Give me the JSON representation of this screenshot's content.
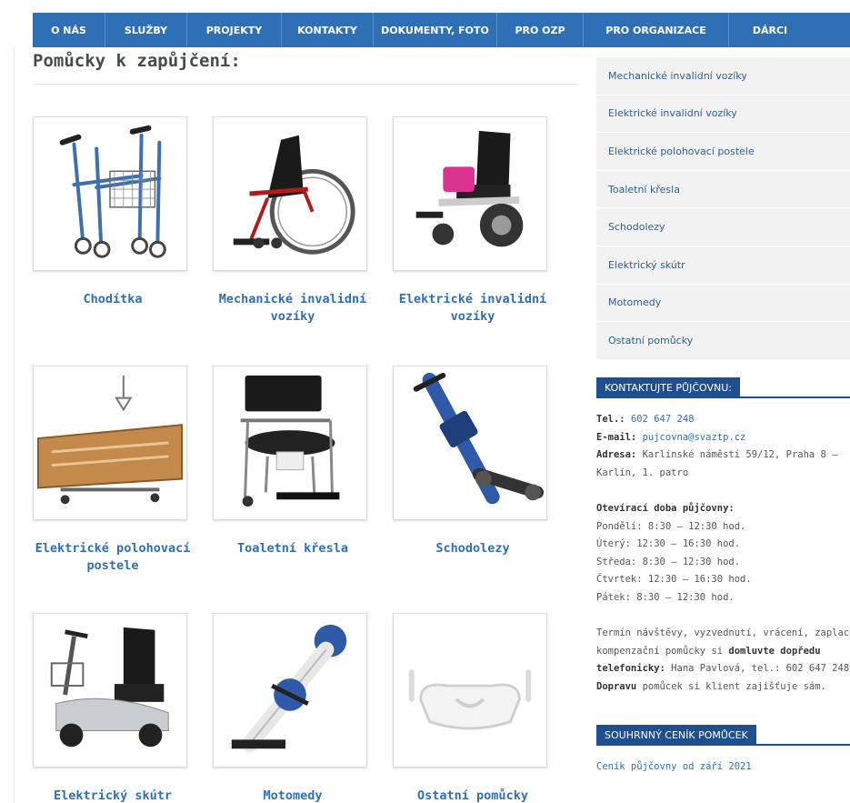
{
  "nav": [
    "O NÁS",
    "SLUŽBY",
    "PROJEKTY",
    "KONTAKTY",
    "DOKUMENTY, FOTO",
    "PRO OZP",
    "PRO ORGANIZACE",
    "DÁRCI"
  ],
  "page": {
    "title": "Pomůcky k zapůjčení:"
  },
  "products": [
    {
      "label": "Chodítka",
      "icon": "walker"
    },
    {
      "label": "Mechanické invalidní vozíky",
      "icon": "manual-wheelchair"
    },
    {
      "label": "Elektrické invalidní vozíky",
      "icon": "electric-wheelchair"
    },
    {
      "label": "Elektrické polohovací postele",
      "icon": "hospital-bed"
    },
    {
      "label": "Toaletní křesla",
      "icon": "commode-chair"
    },
    {
      "label": "Schodolezy",
      "icon": "stair-climber"
    },
    {
      "label": "Elektrický skútr",
      "icon": "mobility-scooter"
    },
    {
      "label": "Motomedy",
      "icon": "motomed"
    },
    {
      "label": "Ostatní pomůcky",
      "icon": "bath-seat"
    }
  ],
  "sidebar": {
    "menu": [
      "Mechanické invalidní vozíky",
      "Elektrické invalidní vozíky",
      "Elektrické polohovací postele",
      "Toaletní křesla",
      "Schodolezy",
      "Elektrický skútr",
      "Motomedy",
      "Ostatní pomůcky"
    ],
    "contact_heading": "KONTAKTUJTE PŮJČOVNU:",
    "tel_label": "Tel.:",
    "tel": "602 647 248",
    "email_label": "E-mail:",
    "email": "pujcovna@svaztp.cz",
    "address_label": "Adresa:",
    "address_line1": "Karlínské náměstí 59/12, Praha 8 –",
    "address_line2": "Karlín, 1. patro",
    "hours_title": "Otevírací doba půjčovny:",
    "hours": [
      "Pondělí: 8:30 – 12:30 hod.",
      "Úterý: 12:30 – 16:30 hod.",
      "Středa: 8:30 – 12:30 hod.",
      "Čtvrtek: 12:30 – 16:30 hod.",
      "Pátek: 8:30 – 12:30 hod."
    ],
    "note_1": "Termín návštěvy, vyzvednutí, vrácení, zaplacení",
    "note_2a": "kompenzační pomůcky si ",
    "note_2b": "domluvte dopředu",
    "note_3a": "telefonicky:",
    "note_3b": " Hana Pavlová, tel.: 602 647 248.",
    "note_4a": "Dopravu",
    "note_4b": " pomůcek si klient zajišťuje sám.",
    "price_heading": "SOUHRNNÝ CENÍK POMŮCEK",
    "price_link": "Ceník půjčovny od září 2021"
  },
  "colors": {
    "nav_bg": "#2f6fb5",
    "heading_bg": "#1f4f8f",
    "link": "#2f6fb5"
  }
}
